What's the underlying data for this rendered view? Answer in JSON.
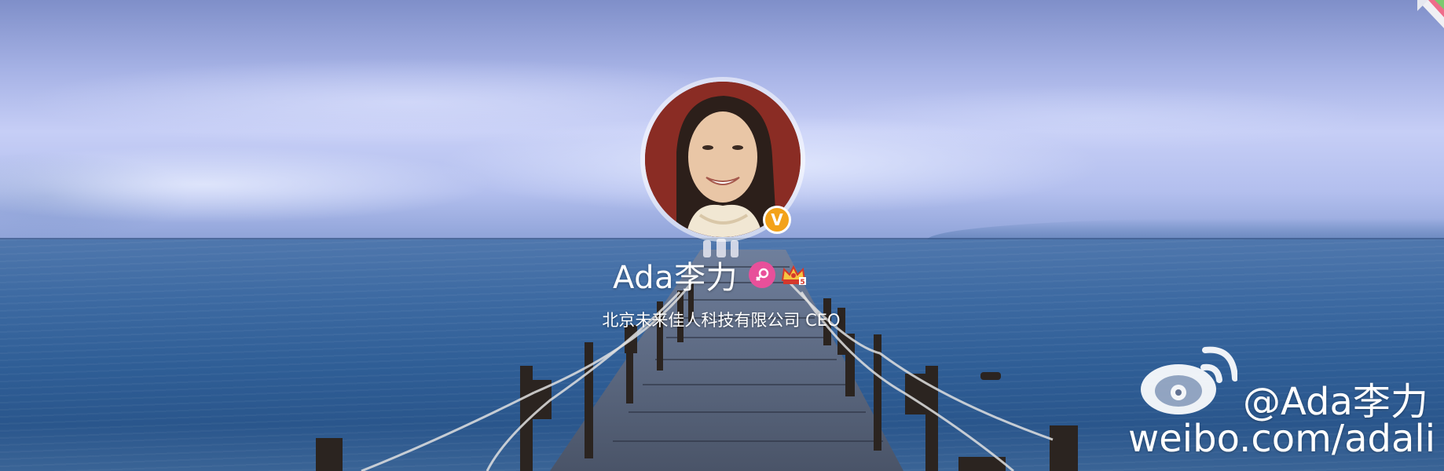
{
  "profile": {
    "name": "Ada李力",
    "title": "北京未来佳人科技有限公司 CEO",
    "verified_badge": "V",
    "gender_icon": "female-icon",
    "vip_icon": "crown-icon"
  },
  "watermark": {
    "handle": "@Ada李力",
    "url": "weibo.com/adali",
    "logo_icon": "weibo-logo-icon"
  },
  "colors": {
    "verified_badge": "#f3a21a",
    "gender_badge": "#e8509a",
    "text": "#ffffff"
  }
}
